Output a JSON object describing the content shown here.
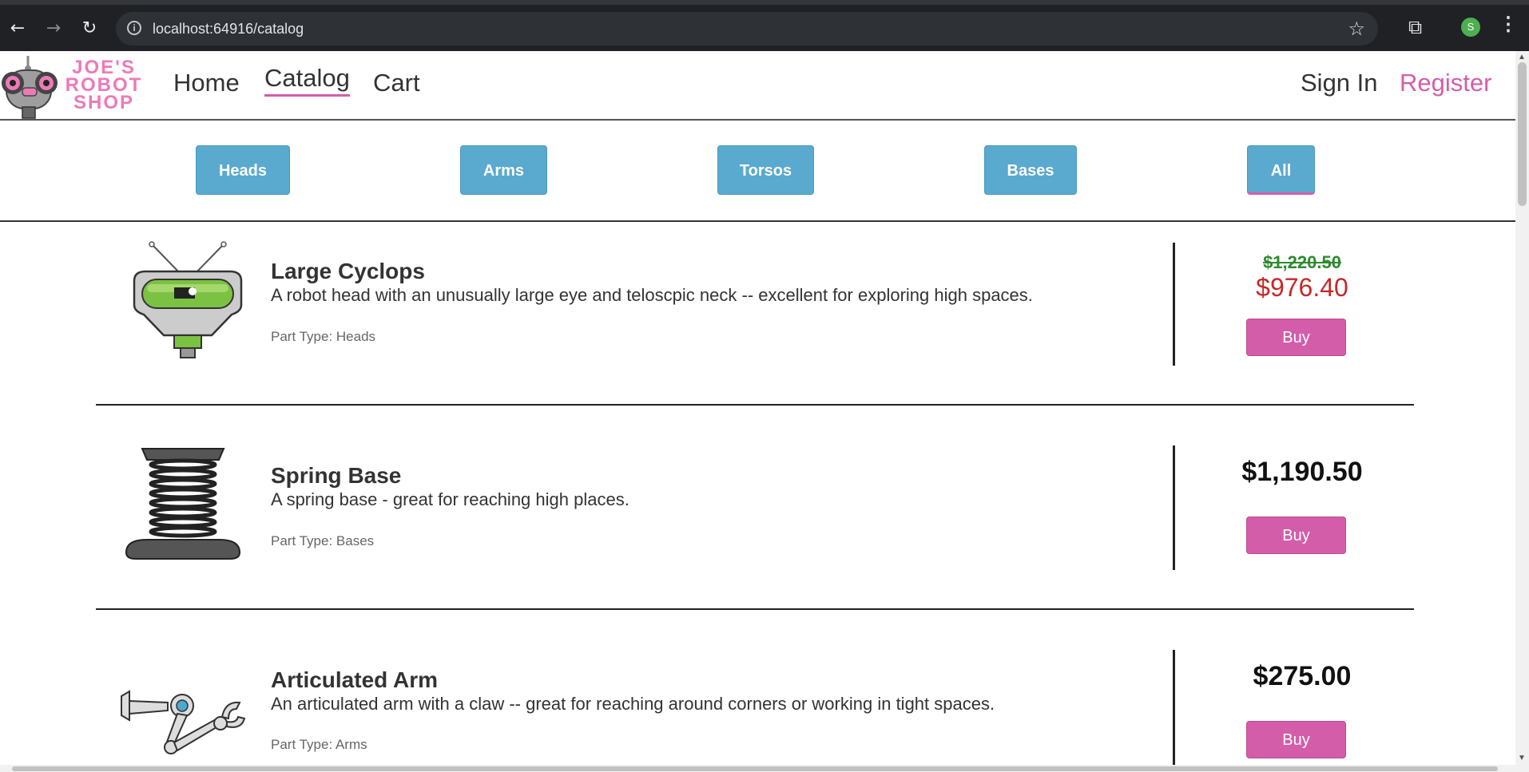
{
  "browser": {
    "url": "localhost:64916/catalog",
    "profile_initial": "S"
  },
  "site": {
    "logo_text": [
      "JOE'S",
      "ROBOT",
      "SHOP"
    ],
    "nav": {
      "home": "Home",
      "catalog": "Catalog",
      "cart": "Cart"
    },
    "sign_in": "Sign In",
    "register": "Register"
  },
  "filters": [
    "Heads",
    "Arms",
    "Torsos",
    "Bases",
    "All"
  ],
  "active_filter": "All",
  "products": [
    {
      "name": "Large Cyclops",
      "description": "A robot head with an unusually large eye and teloscpic neck -- excellent for exploring high spaces.",
      "part_type": "Part Type: Heads",
      "original_price": "$1,220.50",
      "sale_price": "$976.40",
      "buy_label": "Buy"
    },
    {
      "name": "Spring Base",
      "description": "A spring base - great for reaching high places.",
      "part_type": "Part Type: Bases",
      "price": "$1,190.50",
      "buy_label": "Buy"
    },
    {
      "name": "Articulated Arm",
      "description": "An articulated arm with a claw -- great for reaching around corners or working in tight spaces.",
      "part_type": "Part Type: Arms",
      "price": "$275.00",
      "buy_label": "Buy"
    }
  ],
  "colors": {
    "accent_pink": "#d45daa",
    "filter_blue": "#5aa9cf",
    "sale_red": "#c62828",
    "old_price_green": "#2e8b2e"
  }
}
